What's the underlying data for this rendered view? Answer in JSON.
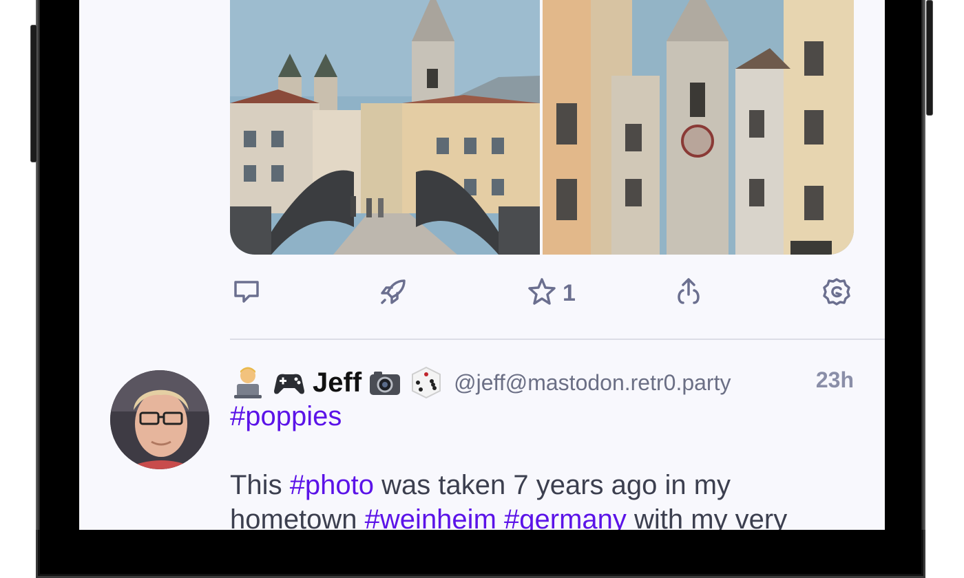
{
  "actions": {
    "reply_label": "Reply",
    "boost_label": "Boost",
    "favorite_count": "1",
    "share_label": "Share",
    "more_label": "More"
  },
  "next_post": {
    "display_name": "Jeff",
    "handle": "@jeff@mastodon.retr0.party",
    "time": "23h",
    "tag_poppies": "#poppies",
    "line2_prefix": "This ",
    "tag_photo": "#photo",
    "line2_suffix": " was taken 7 years ago in my",
    "line3_prefix": "hometown ",
    "tag_weinheim": "#weinheim",
    "line3_space": " ",
    "tag_germany": "#germany",
    "line3_suffix": " with my very"
  },
  "icons": {
    "reply": "reply-icon",
    "boost": "rocket-icon",
    "favorite": "star-icon",
    "share": "share-icon",
    "more": "gear-icon"
  },
  "colors": {
    "hashtag": "#5b13e8",
    "icon": "#6b6f8f",
    "screen_bg": "#f8f8fd"
  }
}
